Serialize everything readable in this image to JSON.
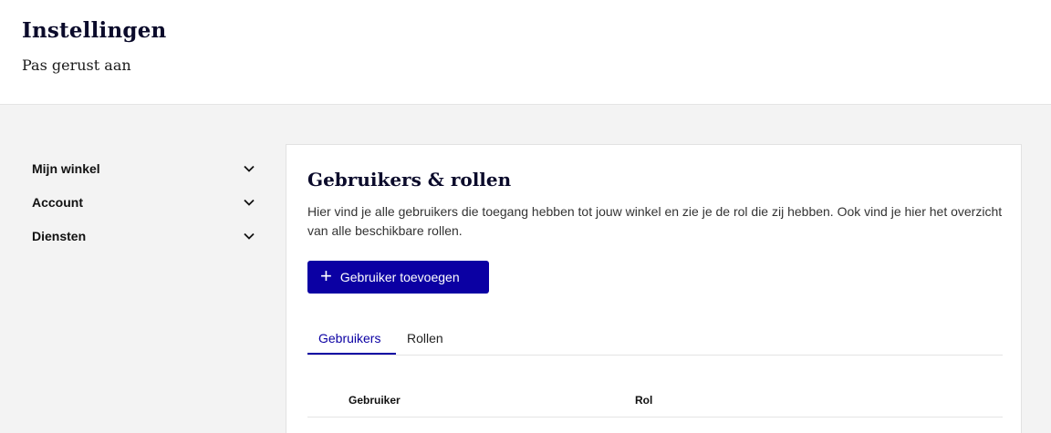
{
  "header": {
    "title": "Instellingen",
    "subtitle": "Pas gerust aan"
  },
  "sidebar": {
    "items": [
      {
        "label": "Mijn winkel",
        "icon": "chevron-down-icon"
      },
      {
        "label": "Account",
        "icon": "chevron-down-icon"
      },
      {
        "label": "Diensten",
        "icon": "chevron-down-icon"
      }
    ]
  },
  "main": {
    "title": "Gebruikers & rollen",
    "description": "Hier vind je alle gebruikers die toegang hebben tot jouw winkel en zie je de rol die zij hebben. Ook vind je hier het overzicht van alle beschikbare rollen.",
    "add_button": {
      "icon": "plus-icon",
      "label": "Gebruiker toevoegen"
    },
    "tabs": [
      {
        "label": "Gebruikers",
        "active": true
      },
      {
        "label": "Rollen",
        "active": false
      }
    ],
    "table": {
      "columns": [
        "Gebruiker",
        "Rol"
      ]
    }
  },
  "colors": {
    "accent": "#0b00a3",
    "background": "#f3f3f3",
    "card": "#ffffff"
  }
}
